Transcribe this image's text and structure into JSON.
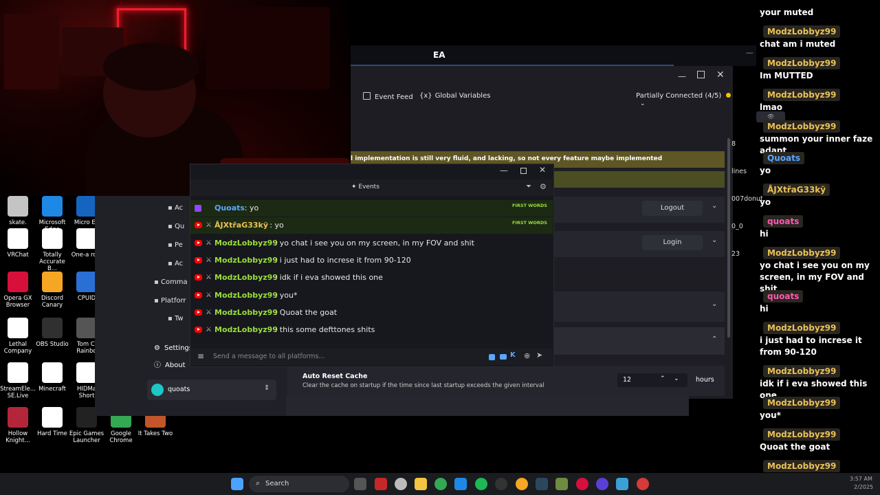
{
  "desktop_icons": [
    {
      "label": "skate.",
      "color": "#c4c4c4"
    },
    {
      "label": "Microsoft Edge",
      "color": "#1e88e5"
    },
    {
      "label": "Micro Ed",
      "color": "#1565c0"
    },
    {
      "label": "VRChat",
      "color": "#ffffff"
    },
    {
      "label": "Totally Accurate B...",
      "color": "#ffffff"
    },
    {
      "label": "One-a robl",
      "color": "#ffffff"
    },
    {
      "label": "Opera GX Browser",
      "color": "#d6103b"
    },
    {
      "label": "Discord Canary",
      "color": "#f5a623"
    },
    {
      "label": "CPUID",
      "color": "#2a6fd6"
    },
    {
      "label": "Lethal Company",
      "color": "#ffffff"
    },
    {
      "label": "OBS Studio",
      "color": "#303030"
    },
    {
      "label": "Tom Cl Rainbo",
      "color": "#555555"
    },
    {
      "label": "StreamEle... SE.Live",
      "color": "#ffffff"
    },
    {
      "label": "Minecraft",
      "color": "#ffffff"
    },
    {
      "label": "HIDMa Short",
      "color": "#ffffff"
    },
    {
      "label": "Hollow Knight...",
      "color": "#b3263a"
    },
    {
      "label": "Hard Time",
      "color": "#ffffff"
    },
    {
      "label": "Epic Games Launcher",
      "color": "#222222"
    },
    {
      "label": "Google Chrome",
      "color": "#34a853"
    },
    {
      "label": "It Takes Two",
      "color": "#c2552a"
    }
  ],
  "ea_window": {
    "title": "EA"
  },
  "app": {
    "toolbar": {
      "event_feed": "Event Feed",
      "global_variables": "Global Variables",
      "connection_status": "Partially Connected (4/5)"
    },
    "warning_text": "l implementation is still very fluid, and lacking, so not every feature maybe implemented",
    "logout_label": "Logout",
    "login_label": "Login",
    "side_text": [
      "8",
      "lines",
      "007donut",
      "0_0",
      "23"
    ],
    "auto_reset": {
      "title": "Auto Reset Cache",
      "description": "Clear the cache on startup if the time since last startup exceeds the given interval",
      "value": "12",
      "unit": "hours"
    }
  },
  "left_panel": {
    "nav": [
      {
        "label": "Ac"
      },
      {
        "label": "Qu"
      },
      {
        "label": "Pe"
      },
      {
        "label": "Ac"
      },
      {
        "label": "Comma"
      },
      {
        "label": "Platforr"
      },
      {
        "label": "Tw"
      }
    ],
    "settings": "Settings",
    "about": "About",
    "account": "quoats"
  },
  "chat_window": {
    "tab": "Events",
    "badge": "FIRST WORDS",
    "messages": [
      {
        "platform": "twitch",
        "user": "Quoats",
        "text": ": yo",
        "color": "#5aa7ff",
        "first": true
      },
      {
        "platform": "youtube",
        "user": "ÅJXtřaG33kÿ",
        "text": ": yo",
        "color": "#e9c157",
        "first": true
      },
      {
        "platform": "youtube",
        "user": "ModzLobbyz99",
        "text": ": yo chat i see you on my screen, in my FOV and shit",
        "color": "#9adf3a",
        "first": false
      },
      {
        "platform": "youtube",
        "user": "ModzLobbyz99",
        "text": ": i just had to increse it from 90-120",
        "color": "#9adf3a",
        "first": false
      },
      {
        "platform": "youtube",
        "user": "ModzLobbyz99",
        "text": ": idk if i eva showed this one",
        "color": "#9adf3a",
        "first": false
      },
      {
        "platform": "youtube",
        "user": "ModzLobbyz99",
        "text": ": you*",
        "color": "#9adf3a",
        "first": false
      },
      {
        "platform": "youtube",
        "user": "ModzLobbyz99",
        "text": ": Quoat the goat",
        "color": "#9adf3a",
        "first": false
      },
      {
        "platform": "youtube",
        "user": "ModzLobbyz99",
        "text": ": this some defttones shits",
        "color": "#9adf3a",
        "first": false
      }
    ],
    "input_placeholder": "Send a message to all platforms..."
  },
  "overlay_chat": [
    {
      "text": "your muted"
    },
    {
      "name": "ModzLobbyz99",
      "text": "chat am i muted"
    },
    {
      "name": "ModzLobbyz99",
      "text": "Im MUTTED"
    },
    {
      "name": "ModzLobbyz99",
      "text": "lmao"
    },
    {
      "name": "ModzLobbyz99",
      "text": "summon your inner faze adapt"
    },
    {
      "name": "Quoats",
      "text": "yo",
      "name_color": "#5aa7ff"
    },
    {
      "name": "ÅJXtřaG33kÿ",
      "text": "yo"
    },
    {
      "name": "quoats",
      "text": "hi",
      "name_color": "#ff5ab4"
    },
    {
      "name": "ModzLobbyz99",
      "text": "yo chat i see you on my screen, in my FOV and shit"
    },
    {
      "name": "quoats",
      "text": "hi",
      "name_color": "#ff5ab4"
    },
    {
      "name": "ModzLobbyz99",
      "text": "i just had to increse it from 90-120"
    },
    {
      "name": "ModzLobbyz99",
      "text": "idk if i eva showed this one"
    },
    {
      "name": "ModzLobbyz99",
      "text": "you*"
    },
    {
      "name": "ModzLobbyz99",
      "text": "Quoat the goat"
    },
    {
      "name": "ModzLobbyz99",
      "text": "this some defttones shits"
    }
  ],
  "taskbar": {
    "search_placeholder": "Search",
    "clock_time": "3:57 AM",
    "clock_date": "2/2025"
  }
}
